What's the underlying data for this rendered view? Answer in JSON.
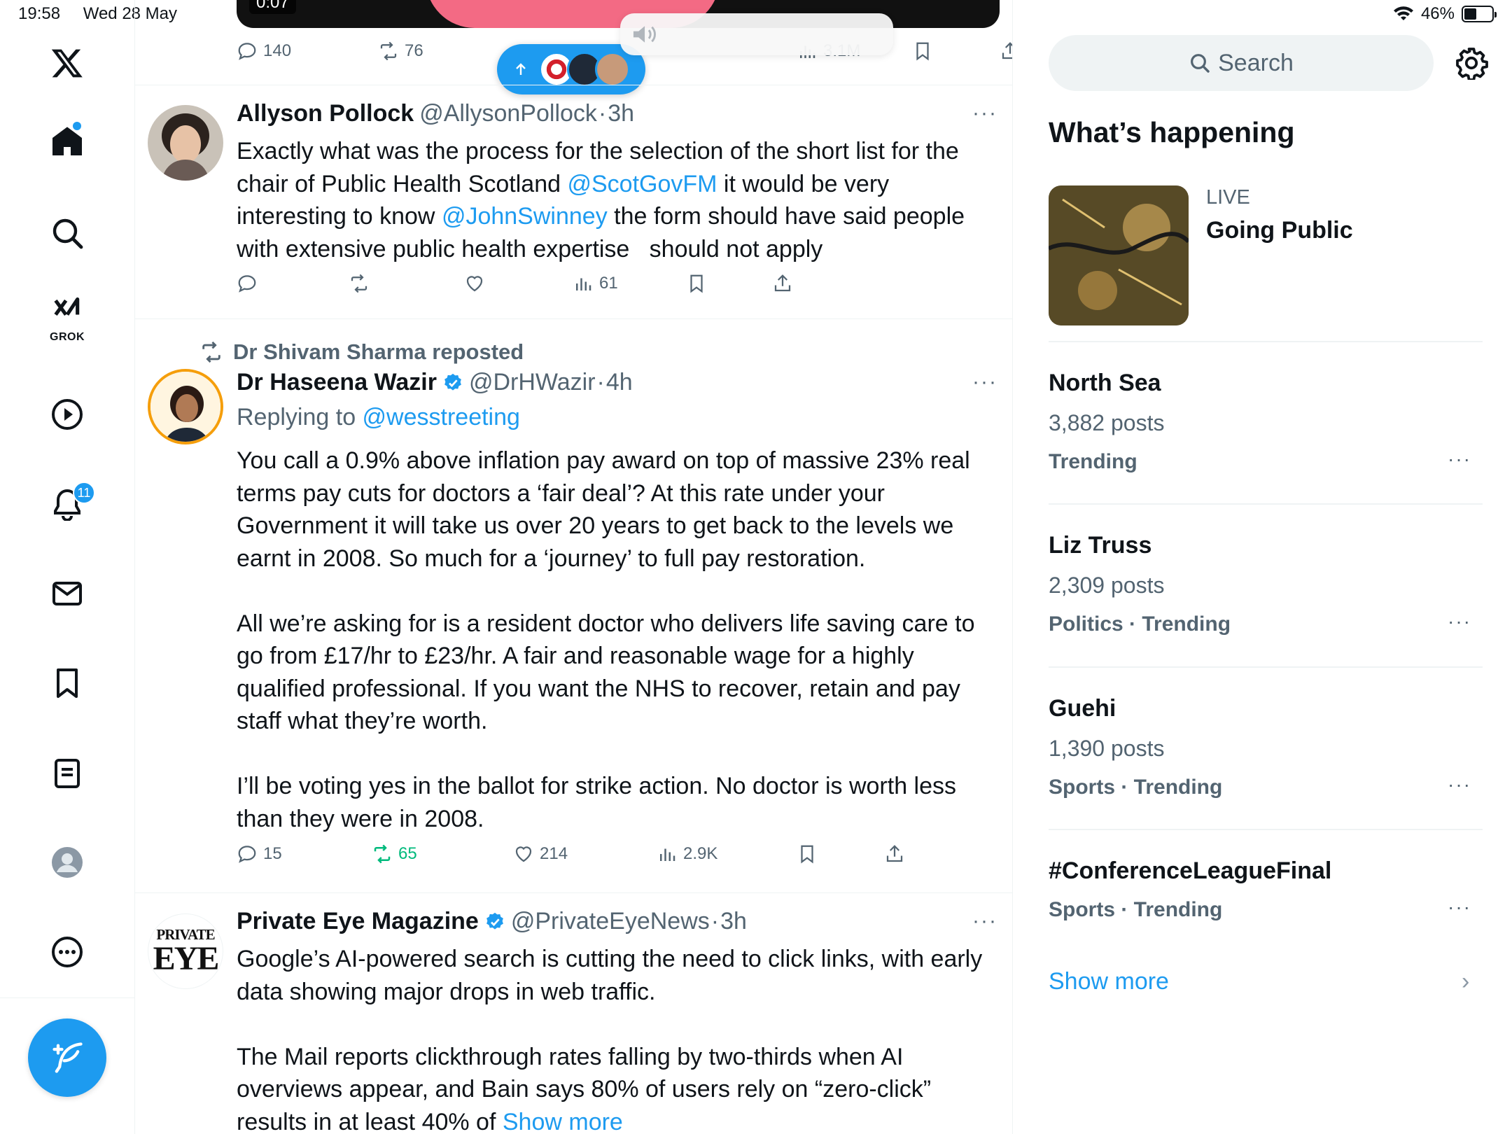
{
  "status": {
    "time": "19:58",
    "date": "Wed 28 May",
    "battery": "46%",
    "battery_level": 0.46
  },
  "nav": {
    "grok_label": "GROK",
    "notifications_count": "11",
    "home_has_new": true
  },
  "feed": {
    "prev_media_time": "0:07",
    "prev_actions": {
      "replies": "140",
      "reposts": "76",
      "views": "3.1M"
    },
    "tweets": [
      {
        "name": "Allyson Pollock",
        "handle": "@AllysonPollock",
        "dot": "·",
        "time": "3h",
        "more": "···",
        "body_lines": [
          "Exactly what was the process for the selection of the short list for the",
          "chair of Public Health Scotland ",
          "@ScotGovFM",
          " it would be very",
          "interesting to know ",
          "@JohnSwinney",
          " the form should have said people",
          "with extensive public health expertise   should not apply"
        ],
        "actions": {
          "replies": "",
          "reposts": "",
          "likes": "",
          "views": "61"
        }
      },
      {
        "repost_by": "Dr Shivam Sharma reposted",
        "name": "Dr Haseena Wazir",
        "handle": "@DrHWazir",
        "dot": "·",
        "time": "4h",
        "more": "···",
        "reply_prefix": "Replying to ",
        "reply_to": "@wesstreeting",
        "paragraphs": [
          [
            "You call a 0.9% above inflation pay award on top of massive 23% real",
            "terms pay cuts for doctors a ‘fair deal’? At this rate under your",
            "Government it will take us over 20 years to get back to the levels we",
            "earnt in 2008. So much for a ‘journey’ to full pay restoration."
          ],
          [
            "All we’re asking for is a resident doctor who delivers life saving care to",
            "go from £17/hr to £23/hr. A fair and reasonable wage for a highly",
            "qualified professional. If you want the NHS to recover, retain and pay",
            "staff what they’re worth."
          ],
          [
            "I’ll be voting yes in the ballot for strike action. No doctor is worth less",
            "than they were in 2008."
          ]
        ],
        "actions": {
          "replies": "15",
          "reposts": "65",
          "likes": "214",
          "views": "2.9K"
        }
      },
      {
        "name": "Private Eye Magazine",
        "handle": "@PrivateEyeNews",
        "dot": "·",
        "time": "3h",
        "more": "···",
        "avatar_text_1": "PRIVATE",
        "avatar_text_2": "EYE",
        "paragraphs": [
          [
            "Google’s AI-powered search is cutting the need to click links, with early",
            "data showing major drops in web traffic."
          ],
          [
            "The Mail reports clickthrough rates falling by two-thirds when AI",
            "overviews appear, and Bain says 80% of users rely on “zero-click”"
          ]
        ],
        "last_line": "results in at least 40% of ",
        "show_more": "Show more"
      }
    ]
  },
  "sidebar": {
    "search_placeholder": "Search",
    "whats_happening": "What’s happening",
    "live": {
      "label": "LIVE",
      "title": "Going Public"
    },
    "trends": [
      {
        "name": "North Sea",
        "posts": "3,882 posts",
        "category": "Trending",
        "more": "···"
      },
      {
        "name": "Liz Truss",
        "posts": "2,309 posts",
        "category": "Politics · Trending",
        "more": "···"
      },
      {
        "name": "Guehi",
        "posts": "1,390 posts",
        "category": "Sports · Trending",
        "more": "···"
      },
      {
        "name": "#ConferenceLeagueFinal",
        "posts": "",
        "category": "Sports · Trending",
        "more": "···"
      }
    ],
    "show_more": "Show more",
    "show_more_chevron": "›"
  },
  "colors": {
    "accent": "#1d9bf0",
    "secondary_text": "#536471",
    "repost_green": "#00ba7c",
    "divider": "#eff3f4"
  }
}
